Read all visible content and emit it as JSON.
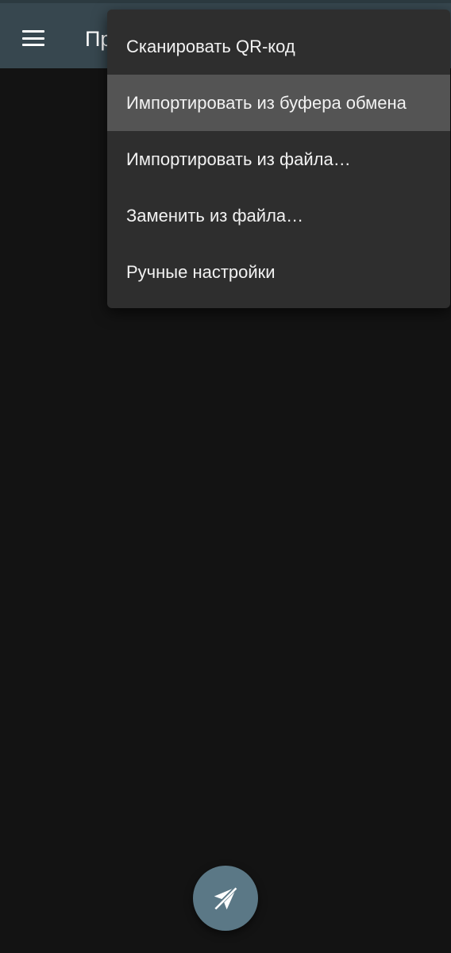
{
  "topbar": {
    "title": "Пр",
    "menu_icon": "hamburger-menu-icon"
  },
  "popup_menu": {
    "items": [
      {
        "label": "Сканировать QR-код",
        "selected": false
      },
      {
        "label": "Импортировать из буфера обмена",
        "selected": true
      },
      {
        "label": "Импортировать из файла…",
        "selected": false
      },
      {
        "label": "Заменить из файла…",
        "selected": false
      },
      {
        "label": "Ручные настройки",
        "selected": false
      }
    ]
  },
  "fab": {
    "icon": "paper-plane-off-icon"
  },
  "colors": {
    "background": "#131313",
    "toolbar": "#37474f",
    "menu_background": "#2e2e2e",
    "menu_selected": "#545454",
    "fab": "#5b7886"
  }
}
